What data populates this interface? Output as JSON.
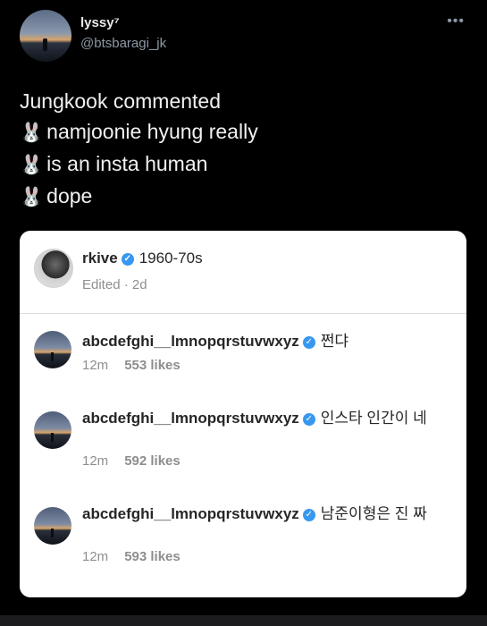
{
  "tweet": {
    "author_name": "lyssy⁷",
    "author_handle": "@btsbaragi_jk",
    "more_label": "•••",
    "lines": [
      "Jungkook commented",
      "namjoonie hyung really",
      "is an insta human",
      "dope"
    ],
    "line_emoji": "🐰"
  },
  "card": {
    "post": {
      "username": "rkive",
      "caption": "1960-70s",
      "meta": "Edited · 2d"
    },
    "comments": [
      {
        "username": "abcdefghi__lmnopqrstuvwxyz",
        "text": "쩐댜",
        "time": "12m",
        "likes": "553 likes"
      },
      {
        "username": "abcdefghi__lmnopqrstuvwxyz",
        "text": "인스타 인간이 네",
        "time": "12m",
        "likes": "592 likes"
      },
      {
        "username": "abcdefghi__lmnopqrstuvwxyz",
        "text": "남준이형은 진 짜",
        "time": "12m",
        "likes": "593 likes"
      }
    ]
  },
  "icons": {
    "verified": "verified-check-icon",
    "more": "more-dots-icon"
  },
  "colors": {
    "background": "#000000",
    "verified": "#3897f0",
    "card": "#ffffff"
  }
}
